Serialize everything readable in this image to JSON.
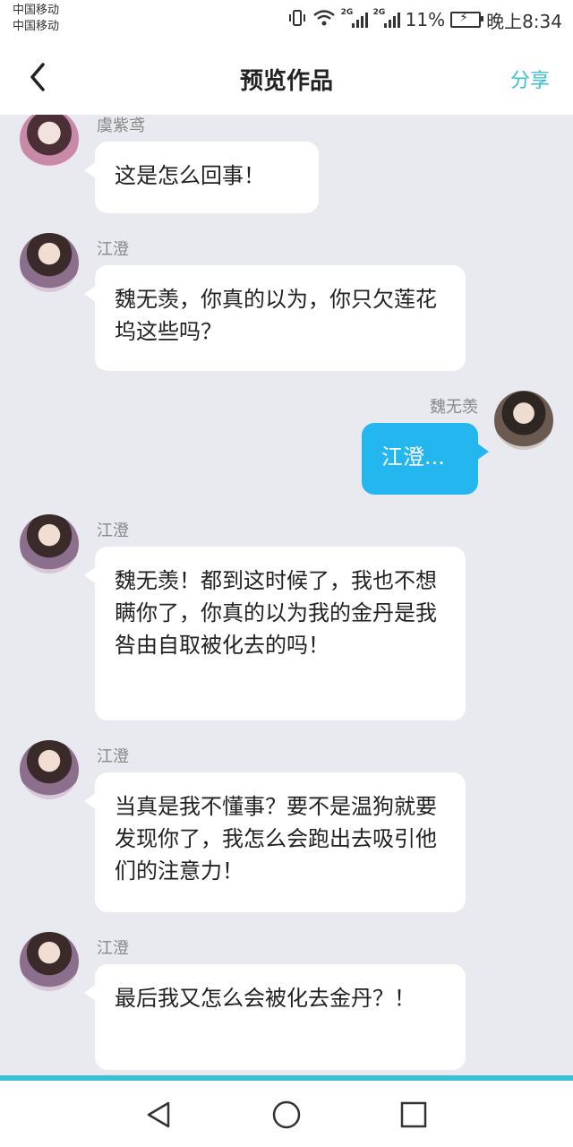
{
  "status_bar": {
    "carrier1": "中国移动",
    "carrier2": "中国移动",
    "network1": "2G",
    "network2": "2G",
    "battery_percent": "11%",
    "time": "晚上8:34",
    "icons": [
      "vibrate-icon",
      "wifi-icon",
      "signal-icon",
      "signal-icon",
      "battery-charging-icon"
    ]
  },
  "navbar": {
    "title": "预览作品",
    "share_label": "分享",
    "back_icon": "back-chevron-icon"
  },
  "messages": [
    {
      "sender": "虞紫鸢",
      "side": "left",
      "text": "这是怎么回事！"
    },
    {
      "sender": "江澄",
      "side": "left",
      "text": "魏无羡，你真的以为，你只欠莲花坞这些吗？"
    },
    {
      "sender": "魏无羡",
      "side": "right",
      "text": "江澄..."
    },
    {
      "sender": "江澄",
      "side": "left",
      "text": "魏无羡！都到这时候了，我也不想瞒你了，你真的以为我的金丹是我咎由自取被化去的吗！"
    },
    {
      "sender": "江澄",
      "side": "left",
      "text": "当真是我不懂事？要不是温狗就要发现你了，我怎么会跑出去吸引他们的注意力！"
    },
    {
      "sender": "江澄",
      "side": "left",
      "text": "最后我又怎么会被化去金丹？！"
    }
  ],
  "colors": {
    "accent": "#3cc0d4",
    "right_bubble": "#24b6ef",
    "chat_background": "#e9eaef"
  },
  "system_nav": [
    "back-triangle-icon",
    "home-circle-icon",
    "recents-square-icon"
  ]
}
